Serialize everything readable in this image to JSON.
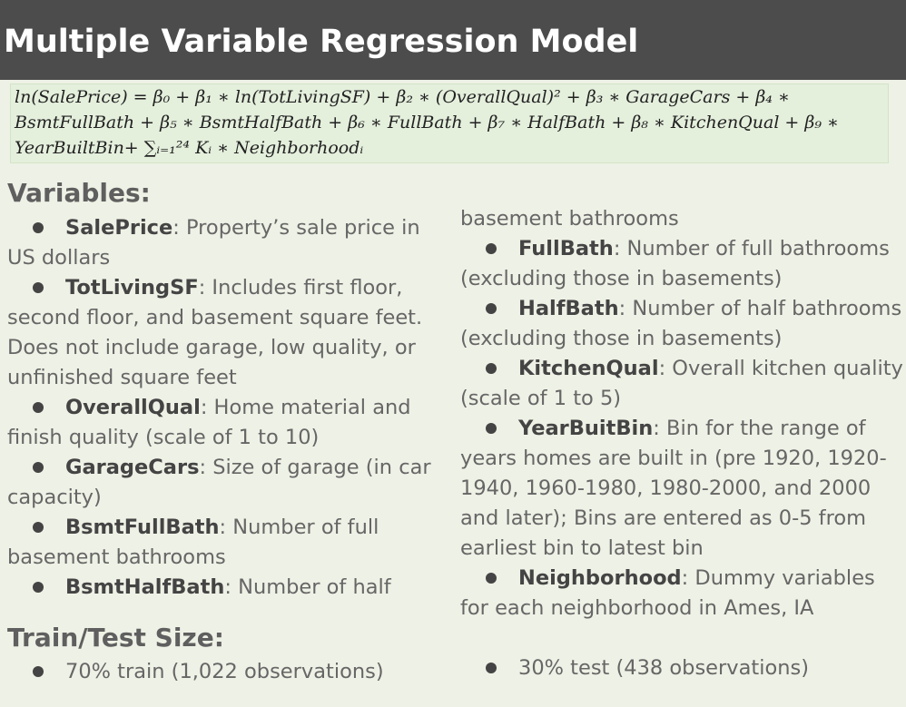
{
  "header": {
    "title": "Multiple Variable Regression Model"
  },
  "formula": {
    "line1": "ln(SalePrice) = β₀ + β₁ ∗ ln(TotLivingSF) + β₂ ∗ (OverallQual)² + β₃ ∗ GarageCars + β₄ ∗",
    "line2": "BsmtFullBath + β₅ ∗ BsmtHalfBath + β₆ ∗ FullBath + β₇ ∗ HalfBath + β₈ ∗ KitchenQual + β₉ ∗",
    "line3": "YearBuiltBin+ ∑ᵢ₌₁²⁴ Kᵢ ∗ Neighborhoodᵢ"
  },
  "variables": {
    "heading": "Variables:",
    "left": [
      {
        "term": "SalePrice",
        "desc": ": Property’s sale price in US dollars"
      },
      {
        "term": "TotLivingSF",
        "desc": ": Includes first floor, second floor, and basement square feet. Does not include garage, low quality, or unfinished square feet"
      },
      {
        "term": "OverallQual",
        "desc": ": Home material and finish quality (scale of 1 to 10)"
      },
      {
        "term": "GarageCars",
        "desc": ": Size of garage (in car capacity)"
      },
      {
        "term": "BsmtFullBath",
        "desc": ": Number of full basement bathrooms"
      },
      {
        "term": "BsmtHalfBath",
        "desc": ": Number of half"
      }
    ],
    "right_continuation": "basement bathrooms",
    "right": [
      {
        "term": "FullBath",
        "desc": ": Number of full bathrooms (excluding those in basements)"
      },
      {
        "term": "HalfBath",
        "desc": ": Number of half bathrooms (excluding those in basements)"
      },
      {
        "term": "KitchenQual",
        "desc": ": Overall kitchen quality (scale of 1 to 5)"
      },
      {
        "term": "YearBuitBin",
        "desc": ": Bin for the range of years homes are built in (pre 1920, 1920-1940, 1960-1980, 1980-2000, and 2000 and later); Bins are entered as 0-5 from earliest bin to latest bin"
      },
      {
        "term": "Neighborhood",
        "desc": ": Dummy variables for each neighborhood in Ames, IA"
      }
    ]
  },
  "train_test": {
    "heading": "Train/Test Size:",
    "train": "70% train (1,022 observations)",
    "test": "30% test (438 observations)"
  }
}
